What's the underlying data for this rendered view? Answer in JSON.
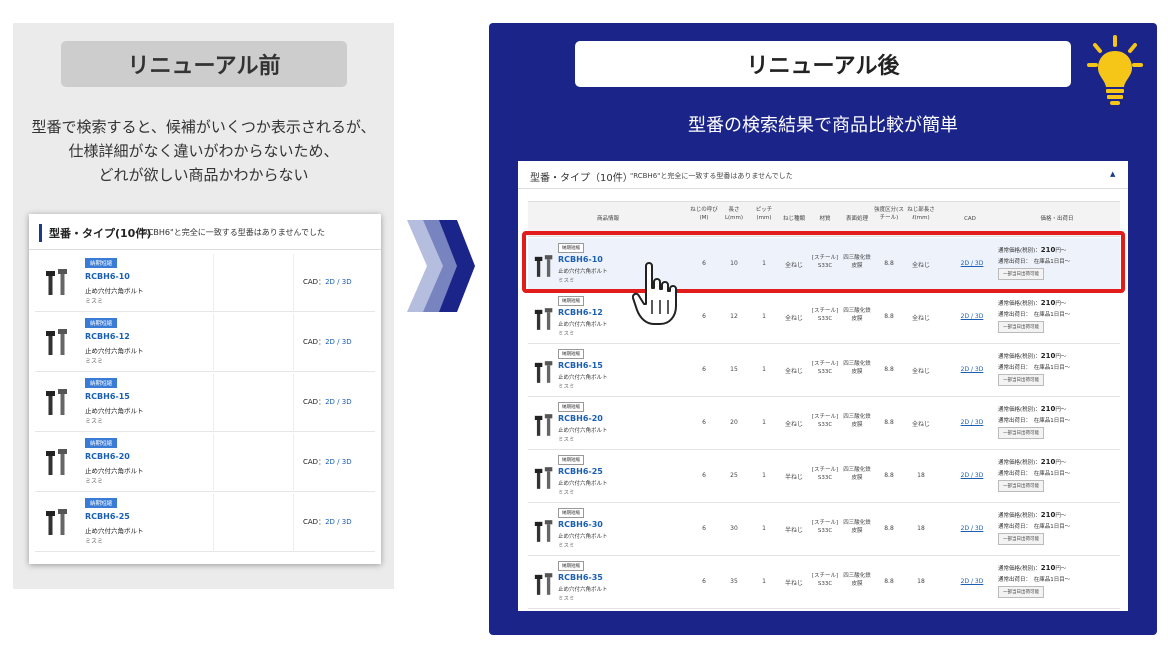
{
  "left": {
    "title": "リニューアル前",
    "desc": [
      "型番で検索すると、候補がいくつか表示されるが、",
      "仕様詳細がなく違いがわからないため、",
      "どれが欲しい商品かわからない"
    ],
    "card": {
      "heading": "型番・タイプ(10件)",
      "note": "\"RCBH6\"と完全に一致する型番はありませんでした",
      "rows": [
        {
          "badge": "納期短縮",
          "code": "RCBH6-10",
          "name": "止め穴付六角ボルト",
          "maker": "ミスミ",
          "cad_label": "CAD：",
          "cad_2d": "2D",
          "cad_sep": " / ",
          "cad_3d": "3D"
        },
        {
          "badge": "納期短縮",
          "code": "RCBH6-12",
          "name": "止め穴付六角ボルト",
          "maker": "ミスミ",
          "cad_label": "CAD：",
          "cad_2d": "2D",
          "cad_sep": " / ",
          "cad_3d": "3D"
        },
        {
          "badge": "納期短縮",
          "code": "RCBH6-15",
          "name": "止め穴付六角ボルト",
          "maker": "ミスミ",
          "cad_label": "CAD：",
          "cad_2d": "2D",
          "cad_sep": " / ",
          "cad_3d": "3D"
        },
        {
          "badge": "納期短縮",
          "code": "RCBH6-20",
          "name": "止め穴付六角ボルト",
          "maker": "ミスミ",
          "cad_label": "CAD：",
          "cad_2d": "2D",
          "cad_sep": " / ",
          "cad_3d": "3D"
        },
        {
          "badge": "納期短縮",
          "code": "RCBH6-25",
          "name": "止め穴付六角ボルト",
          "maker": "ミスミ",
          "cad_label": "CAD：",
          "cad_2d": "2D",
          "cad_sep": " / ",
          "cad_3d": "3D"
        }
      ]
    }
  },
  "right": {
    "title": "リニューアル後",
    "subtitle": "型番の検索結果で商品比較が簡単",
    "card": {
      "heading": "型番・タイプ（10件）",
      "note": "\"RCBH6\"と完全に一致する型番はありませんでした",
      "caret": "▲",
      "columns": [
        "商品情報",
        "ねじの呼び(M)",
        "長さL(mm)",
        "ピッチ(mm)",
        "ねじ種類",
        "材質",
        "表面処理",
        "強度区分(スチール)",
        "ねじ部長さℓ(mm)",
        "CAD",
        "価格・出荷日"
      ],
      "rows": [
        {
          "badge": "納期短縮",
          "code": "RCBH6-10",
          "name": "止め穴付六角ボルト",
          "maker": "ミスミ",
          "m": "6",
          "l": "10",
          "pitch": "1",
          "thread": "全ねじ",
          "material": "[スチール] S33C",
          "surface": "四三酸化鉄皮膜",
          "strength": "8.8",
          "thread_len": "全ねじ",
          "cad": "2D / 3D",
          "price_label": "通常価格(税別)：",
          "price": "210",
          "price_unit": "円〜",
          "ship": "通常出荷日：　在庫品1日目〜",
          "btn": "一部当日出荷可能"
        },
        {
          "badge": "納期短縮",
          "code": "RCBH6-12",
          "name": "止め穴付六角ボルト",
          "maker": "ミスミ",
          "m": "6",
          "l": "12",
          "pitch": "1",
          "thread": "全ねじ",
          "material": "[スチール] S33C",
          "surface": "四三酸化鉄皮膜",
          "strength": "8.8",
          "thread_len": "全ねじ",
          "cad": "2D / 3D",
          "price_label": "通常価格(税別)：",
          "price": "210",
          "price_unit": "円〜",
          "ship": "通常出荷日：　在庫品1日目〜",
          "btn": "一部当日出荷可能"
        },
        {
          "badge": "納期短縮",
          "code": "RCBH6-15",
          "name": "止め穴付六角ボルト",
          "maker": "ミスミ",
          "m": "6",
          "l": "15",
          "pitch": "1",
          "thread": "全ねじ",
          "material": "[スチール] S33C",
          "surface": "四三酸化鉄皮膜",
          "strength": "8.8",
          "thread_len": "全ねじ",
          "cad": "2D / 3D",
          "price_label": "通常価格(税別)：",
          "price": "210",
          "price_unit": "円〜",
          "ship": "通常出荷日：　在庫品1日目〜",
          "btn": "一部当日出荷可能"
        },
        {
          "badge": "納期短縮",
          "code": "RCBH6-20",
          "name": "止め穴付六角ボルト",
          "maker": "ミスミ",
          "m": "6",
          "l": "20",
          "pitch": "1",
          "thread": "全ねじ",
          "material": "[スチール] S33C",
          "surface": "四三酸化鉄皮膜",
          "strength": "8.8",
          "thread_len": "全ねじ",
          "cad": "2D / 3D",
          "price_label": "通常価格(税別)：",
          "price": "210",
          "price_unit": "円〜",
          "ship": "通常出荷日：　在庫品1日目〜",
          "btn": "一部当日出荷可能"
        },
        {
          "badge": "納期短縮",
          "code": "RCBH6-25",
          "name": "止め穴付六角ボルト",
          "maker": "ミスミ",
          "m": "6",
          "l": "25",
          "pitch": "1",
          "thread": "半ねじ",
          "material": "[スチール] S33C",
          "surface": "四三酸化鉄皮膜",
          "strength": "8.8",
          "thread_len": "18",
          "cad": "2D / 3D",
          "price_label": "通常価格(税別)：",
          "price": "210",
          "price_unit": "円〜",
          "ship": "通常出荷日：　在庫品1日目〜",
          "btn": "一部当日出荷可能"
        },
        {
          "badge": "納期短縮",
          "code": "RCBH6-30",
          "name": "止め穴付六角ボルト",
          "maker": "ミスミ",
          "m": "6",
          "l": "30",
          "pitch": "1",
          "thread": "半ねじ",
          "material": "[スチール] S33C",
          "surface": "四三酸化鉄皮膜",
          "strength": "8.8",
          "thread_len": "18",
          "cad": "2D / 3D",
          "price_label": "通常価格(税別)：",
          "price": "210",
          "price_unit": "円〜",
          "ship": "通常出荷日：　在庫品1日目〜",
          "btn": "一部当日出荷可能"
        },
        {
          "badge": "納期短縮",
          "code": "RCBH6-35",
          "name": "止め穴付六角ボルト",
          "maker": "ミスミ",
          "m": "6",
          "l": "35",
          "pitch": "1",
          "thread": "半ねじ",
          "material": "[スチール] S33C",
          "surface": "四三酸化鉄皮膜",
          "strength": "8.8",
          "thread_len": "18",
          "cad": "2D / 3D",
          "price_label": "通常価格(税別)：",
          "price": "210",
          "price_unit": "円〜",
          "ship": "通常出荷日：　在庫品1日目〜",
          "btn": "一部当日出荷可能"
        }
      ]
    }
  },
  "colors": {
    "right_bg": "#1b2488",
    "highlight": "#e21b1b",
    "link": "#1a5fb4",
    "arrow_light": "#9aa6d6",
    "arrow_dark": "#1b2488",
    "bulb": "#f5c518"
  },
  "icons": {
    "arrows": "chevron-right-icon",
    "bulb": "lightbulb-icon",
    "cursor": "hand-pointer-icon",
    "product": "bolt-icon"
  }
}
